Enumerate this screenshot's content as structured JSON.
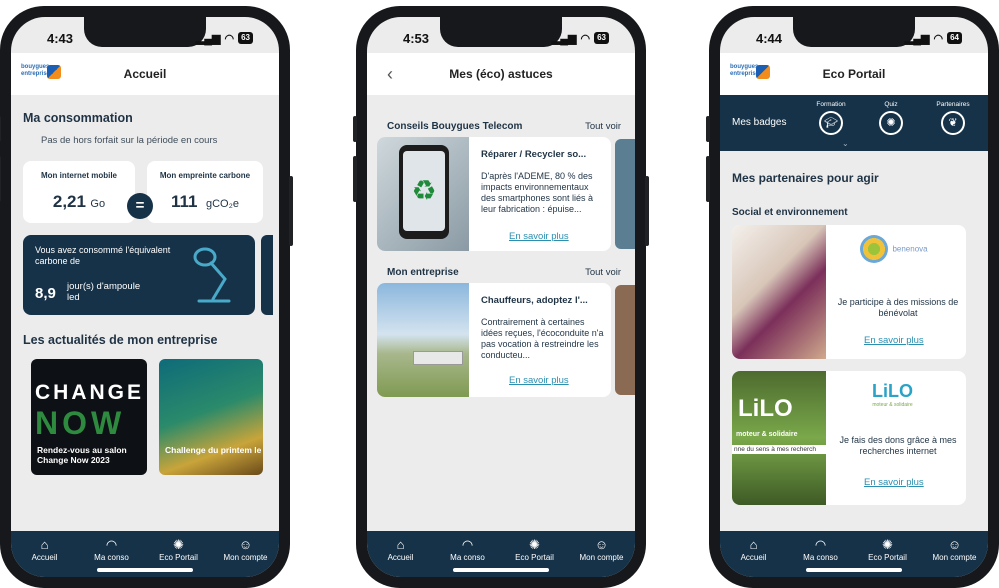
{
  "colors": {
    "navy": "#163248",
    "accent": "#2b8fb0",
    "background": "#ececec"
  },
  "tabbar": [
    {
      "label": "Accueil",
      "icon": "home-icon"
    },
    {
      "label": "Ma conso",
      "icon": "gauge-icon"
    },
    {
      "label": "Eco Portail",
      "icon": "lightbulb-icon"
    },
    {
      "label": "Mon compte",
      "icon": "account-icon"
    }
  ],
  "phone1": {
    "time": "4:43",
    "battery": "63",
    "logo": "bouygues entreprises",
    "header_title": "Accueil",
    "consumption_title": "Ma consommation",
    "no_overage": "Pas de hors forfait sur la période en cours",
    "internet_label": "Mon internet mobile",
    "internet_value": "2,21",
    "internet_unit": "Go",
    "equals": "=",
    "carbon_label": "Mon empreinte carbone",
    "carbon_value": "111",
    "carbon_unit": "gCO₂e",
    "equiv_text": "Vous avez consommé l'équivalent carbone de",
    "equiv_value": "8,9",
    "equiv_unit": "jour(s) d'ampoule led",
    "news_title": "Les actualités de mon entreprise",
    "news": [
      {
        "banner_top": "CHANGE",
        "banner_bottom": "NOW",
        "caption": "Rendez-vous au salon Change Now 2023"
      },
      {
        "caption": "Challenge du printem le YOGA time"
      }
    ]
  },
  "phone2": {
    "time": "4:53",
    "battery": "63",
    "header_title": "Mes (éco) astuces",
    "section1_title": "Conseils Bouygues Telecom",
    "see_all": "Tout voir",
    "card1_title": "Réparer / Recycler so...",
    "card1_body": "D'après l'ADEME, 80 % des impacts environnementaux des smartphones sont liés à leur fabrication : épuise...",
    "learn_more": "En savoir plus",
    "section2_title": "Mon entreprise",
    "card2_title": "Chauffeurs, adoptez l'...",
    "card2_body": "Contrairement à certaines idées reçues, l'écoconduite n'a pas vocation à restreindre les conducteu..."
  },
  "phone3": {
    "time": "4:44",
    "battery": "64",
    "logo": "bouygues entreprises",
    "header_title": "Eco Portail",
    "badges_label": "Mes badges",
    "badges": [
      {
        "label": "Formation",
        "icon": "graduation-icon"
      },
      {
        "label": "Quiz",
        "icon": "lightbulb-icon"
      },
      {
        "label": "Partenaires",
        "icon": "handshake-icon"
      }
    ],
    "partners_title": "Mes partenaires pour agir",
    "social_title": "Social et environnement",
    "partner1_logo": "benenova",
    "partner1_text": "Je participe à des missions de bénévolat",
    "partner2_logo": "LiLO",
    "partner2_sub": "moteur & solidaire",
    "partner2_photo_text": "LiLO",
    "partner2_photo_sub1": "moteur & solidaire",
    "partner2_photo_sub2": "nne du sens à mes recherch",
    "partner2_text": "Je fais des dons grâce à mes recherches internet",
    "learn_more": "En savoir plus"
  }
}
